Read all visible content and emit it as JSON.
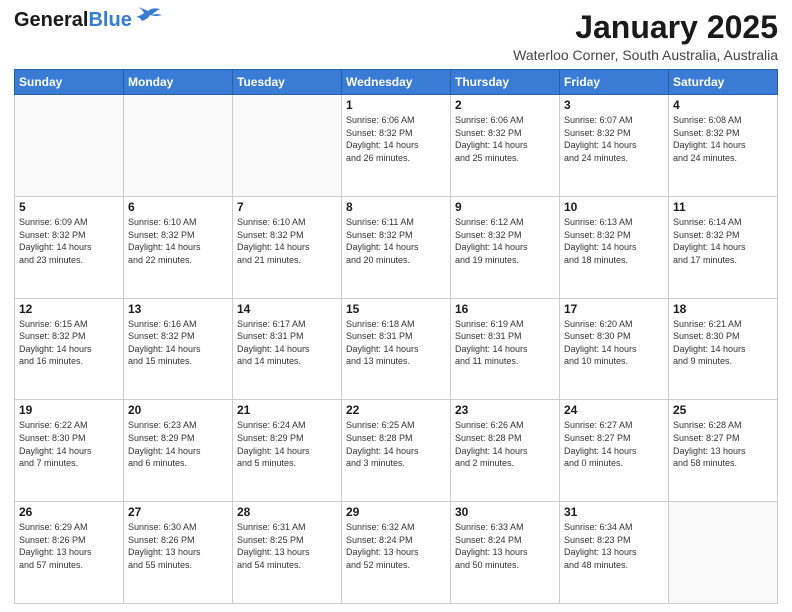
{
  "header": {
    "logo_line1": "General",
    "logo_line2": "Blue",
    "main_title": "January 2025",
    "sub_title": "Waterloo Corner, South Australia, Australia"
  },
  "days_of_week": [
    "Sunday",
    "Monday",
    "Tuesday",
    "Wednesday",
    "Thursday",
    "Friday",
    "Saturday"
  ],
  "weeks": [
    [
      {
        "day": "",
        "info": ""
      },
      {
        "day": "",
        "info": ""
      },
      {
        "day": "",
        "info": ""
      },
      {
        "day": "1",
        "info": "Sunrise: 6:06 AM\nSunset: 8:32 PM\nDaylight: 14 hours\nand 26 minutes."
      },
      {
        "day": "2",
        "info": "Sunrise: 6:06 AM\nSunset: 8:32 PM\nDaylight: 14 hours\nand 25 minutes."
      },
      {
        "day": "3",
        "info": "Sunrise: 6:07 AM\nSunset: 8:32 PM\nDaylight: 14 hours\nand 24 minutes."
      },
      {
        "day": "4",
        "info": "Sunrise: 6:08 AM\nSunset: 8:32 PM\nDaylight: 14 hours\nand 24 minutes."
      }
    ],
    [
      {
        "day": "5",
        "info": "Sunrise: 6:09 AM\nSunset: 8:32 PM\nDaylight: 14 hours\nand 23 minutes."
      },
      {
        "day": "6",
        "info": "Sunrise: 6:10 AM\nSunset: 8:32 PM\nDaylight: 14 hours\nand 22 minutes."
      },
      {
        "day": "7",
        "info": "Sunrise: 6:10 AM\nSunset: 8:32 PM\nDaylight: 14 hours\nand 21 minutes."
      },
      {
        "day": "8",
        "info": "Sunrise: 6:11 AM\nSunset: 8:32 PM\nDaylight: 14 hours\nand 20 minutes."
      },
      {
        "day": "9",
        "info": "Sunrise: 6:12 AM\nSunset: 8:32 PM\nDaylight: 14 hours\nand 19 minutes."
      },
      {
        "day": "10",
        "info": "Sunrise: 6:13 AM\nSunset: 8:32 PM\nDaylight: 14 hours\nand 18 minutes."
      },
      {
        "day": "11",
        "info": "Sunrise: 6:14 AM\nSunset: 8:32 PM\nDaylight: 14 hours\nand 17 minutes."
      }
    ],
    [
      {
        "day": "12",
        "info": "Sunrise: 6:15 AM\nSunset: 8:32 PM\nDaylight: 14 hours\nand 16 minutes."
      },
      {
        "day": "13",
        "info": "Sunrise: 6:16 AM\nSunset: 8:32 PM\nDaylight: 14 hours\nand 15 minutes."
      },
      {
        "day": "14",
        "info": "Sunrise: 6:17 AM\nSunset: 8:31 PM\nDaylight: 14 hours\nand 14 minutes."
      },
      {
        "day": "15",
        "info": "Sunrise: 6:18 AM\nSunset: 8:31 PM\nDaylight: 14 hours\nand 13 minutes."
      },
      {
        "day": "16",
        "info": "Sunrise: 6:19 AM\nSunset: 8:31 PM\nDaylight: 14 hours\nand 11 minutes."
      },
      {
        "day": "17",
        "info": "Sunrise: 6:20 AM\nSunset: 8:30 PM\nDaylight: 14 hours\nand 10 minutes."
      },
      {
        "day": "18",
        "info": "Sunrise: 6:21 AM\nSunset: 8:30 PM\nDaylight: 14 hours\nand 9 minutes."
      }
    ],
    [
      {
        "day": "19",
        "info": "Sunrise: 6:22 AM\nSunset: 8:30 PM\nDaylight: 14 hours\nand 7 minutes."
      },
      {
        "day": "20",
        "info": "Sunrise: 6:23 AM\nSunset: 8:29 PM\nDaylight: 14 hours\nand 6 minutes."
      },
      {
        "day": "21",
        "info": "Sunrise: 6:24 AM\nSunset: 8:29 PM\nDaylight: 14 hours\nand 5 minutes."
      },
      {
        "day": "22",
        "info": "Sunrise: 6:25 AM\nSunset: 8:28 PM\nDaylight: 14 hours\nand 3 minutes."
      },
      {
        "day": "23",
        "info": "Sunrise: 6:26 AM\nSunset: 8:28 PM\nDaylight: 14 hours\nand 2 minutes."
      },
      {
        "day": "24",
        "info": "Sunrise: 6:27 AM\nSunset: 8:27 PM\nDaylight: 14 hours\nand 0 minutes."
      },
      {
        "day": "25",
        "info": "Sunrise: 6:28 AM\nSunset: 8:27 PM\nDaylight: 13 hours\nand 58 minutes."
      }
    ],
    [
      {
        "day": "26",
        "info": "Sunrise: 6:29 AM\nSunset: 8:26 PM\nDaylight: 13 hours\nand 57 minutes."
      },
      {
        "day": "27",
        "info": "Sunrise: 6:30 AM\nSunset: 8:26 PM\nDaylight: 13 hours\nand 55 minutes."
      },
      {
        "day": "28",
        "info": "Sunrise: 6:31 AM\nSunset: 8:25 PM\nDaylight: 13 hours\nand 54 minutes."
      },
      {
        "day": "29",
        "info": "Sunrise: 6:32 AM\nSunset: 8:24 PM\nDaylight: 13 hours\nand 52 minutes."
      },
      {
        "day": "30",
        "info": "Sunrise: 6:33 AM\nSunset: 8:24 PM\nDaylight: 13 hours\nand 50 minutes."
      },
      {
        "day": "31",
        "info": "Sunrise: 6:34 AM\nSunset: 8:23 PM\nDaylight: 13 hours\nand 48 minutes."
      },
      {
        "day": "",
        "info": ""
      }
    ]
  ]
}
